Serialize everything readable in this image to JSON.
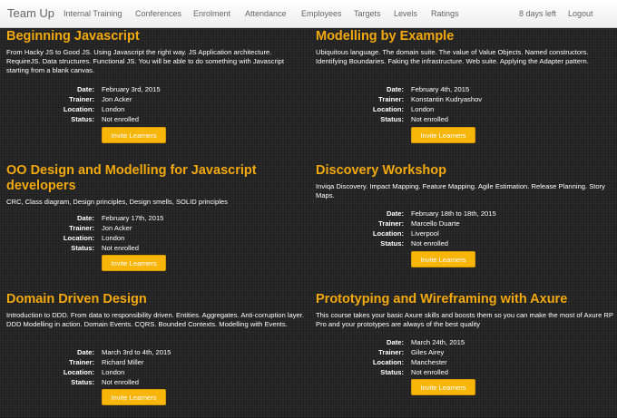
{
  "navbar": {
    "brand": "Team Up",
    "links": [
      "Internal Training",
      "Conferences",
      "Enrolment",
      "Attendance",
      "Employees",
      "Targets",
      "Levels",
      "Ratings"
    ],
    "days_left": "8 days left",
    "logout": "Logout"
  },
  "labels": {
    "date": "Date:",
    "trainer": "Trainer:",
    "location": "Location:",
    "status": "Status:",
    "invite_button": "Invite Learners"
  },
  "courses": [
    {
      "title": "Beginning Javascript",
      "description": "From Hacky JS to Good JS. Using Javascript the right way. JS Application architecture. RequireJS. Data structures. Functional JS. You will be able to do something with Javascript starting from a blank canvas.",
      "date": "February 3rd, 2015",
      "trainer": "Jon Acker",
      "location": "London",
      "status": "Not enrolled"
    },
    {
      "title": "Modelling by Example",
      "description": "Ubiquitous language. The domain suite. The value of Value Objects. Named constructors. Identifying Boundaries. Faking the infrastructure. Web suite. Applying the Adapter pattern.",
      "date": "February 4th, 2015",
      "trainer": "Konstantin Kudryashov",
      "location": "London",
      "status": "Not enrolled"
    },
    {
      "title": "OO Design and Modelling for Javascript developers",
      "description": "CRC, Class diagram, Design principles, Design smells, SOLID principles",
      "date": "February 17th, 2015",
      "trainer": "Jon Acker",
      "location": "London",
      "status": "Not enrolled"
    },
    {
      "title": "Discovery Workshop",
      "description": "Inviqa Discovery. Impact Mapping. Feature Mapping. Agile Estimation. Release Planning. Story Maps.",
      "date": "February 18th to 18th, 2015",
      "trainer": "Marcello Duarte",
      "location": "Liverpool",
      "status": "Not enrolled"
    },
    {
      "title": "Domain Driven Design",
      "description": "Introduction to DDD. From data to responsibility driven. Entities. Aggregates. Anti-corruption layer. DDD Modelling in action. Domain Events. CQRS. Bounded Contexts. Modelling with Events.",
      "date": "March 3rd to 4th, 2015",
      "trainer": "Richard Miller",
      "location": "London",
      "status": "Not enrolled"
    },
    {
      "title": "Prototyping and Wireframing with Axure",
      "description": "This course takes your basic Axure skills and boosts them so you can make the most of Axure RP Pro and your prototypes are always of the best quality",
      "date": "March 24th, 2015",
      "trainer": "Giles Airey",
      "location": "Manchester",
      "status": "Not enrolled"
    }
  ]
}
